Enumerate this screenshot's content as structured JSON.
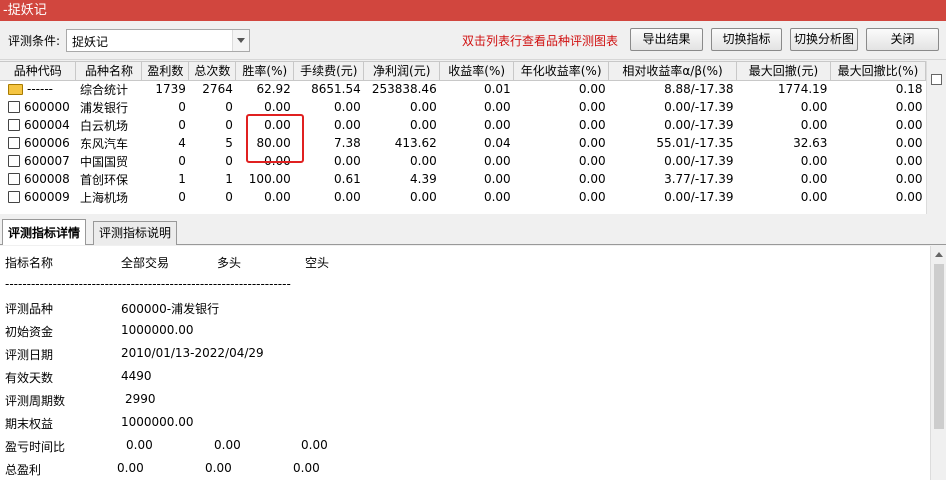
{
  "window": {
    "title": "-捉妖记"
  },
  "toolbar": {
    "condition_label": "评测条件:",
    "condition_value": "捉妖记",
    "hint": "双击列表行查看品种评测图表",
    "export_label": "导出结果",
    "switch_metric_label": "切换指标",
    "switch_chart_label": "切换分析图",
    "close_label": "关闭"
  },
  "table": {
    "columns": [
      "品种代码",
      "品种名称",
      "盈利数",
      "总次数",
      "胜率(%)",
      "手续费(元)",
      "净利润(元)",
      "收益率(%)",
      "年化收益率(%)",
      "相对收益率α/β(%)",
      "最大回撤(元)",
      "最大回撤比(%)"
    ],
    "rows": [
      [
        "------",
        "综合统计",
        "1739",
        "2764",
        "62.92",
        "8651.54",
        "253838.46",
        "0.01",
        "0.00",
        "8.88/-17.38",
        "1774.19",
        "0.18"
      ],
      [
        "600000",
        "浦发银行",
        "0",
        "0",
        "0.00",
        "0.00",
        "0.00",
        "0.00",
        "0.00",
        "0.00/-17.39",
        "0.00",
        "0.00"
      ],
      [
        "600004",
        "白云机场",
        "0",
        "0",
        "0.00",
        "0.00",
        "0.00",
        "0.00",
        "0.00",
        "0.00/-17.39",
        "0.00",
        "0.00"
      ],
      [
        "600006",
        "东风汽车",
        "4",
        "5",
        "80.00",
        "7.38",
        "413.62",
        "0.04",
        "0.00",
        "55.01/-17.35",
        "32.63",
        "0.00"
      ],
      [
        "600007",
        "中国国贸",
        "0",
        "0",
        "0.00",
        "0.00",
        "0.00",
        "0.00",
        "0.00",
        "0.00/-17.39",
        "0.00",
        "0.00"
      ],
      [
        "600008",
        "首创环保",
        "1",
        "1",
        "100.00",
        "0.61",
        "4.39",
        "0.00",
        "0.00",
        "3.77/-17.39",
        "0.00",
        "0.00"
      ],
      [
        "600009",
        "上海机场",
        "0",
        "0",
        "0.00",
        "0.00",
        "0.00",
        "0.00",
        "0.00",
        "0.00/-17.39",
        "0.00",
        "0.00"
      ]
    ]
  },
  "tabs": [
    "评测指标详情",
    "评测指标说明"
  ],
  "detail": {
    "header": [
      "指标名称",
      "全部交易",
      "多头",
      "空头"
    ],
    "separator": "------------------------------------------------------------------",
    "items": [
      {
        "label": "评测品种",
        "values": [
          "600000-浦发银行"
        ]
      },
      {
        "label": "初始资金",
        "values": [
          "1000000.00"
        ]
      },
      {
        "label": "评测日期",
        "values": [
          "2010/01/13-2022/04/29"
        ]
      },
      {
        "label": "有效天数",
        "values": [
          "4490"
        ]
      },
      {
        "label": "评测周期数",
        "values": [
          "2990"
        ]
      },
      {
        "label": "期末权益",
        "values": [
          "1000000.00"
        ]
      },
      {
        "label": "盈亏时间比",
        "values": [
          "0.00",
          "0.00",
          "0.00"
        ]
      },
      {
        "label": "总盈利",
        "values": [
          "0.00",
          "0.00",
          "0.00"
        ]
      }
    ]
  },
  "colors": {
    "titlebar": "#d1463e",
    "hint": "#d01010",
    "highlight_box": "#e02020"
  }
}
